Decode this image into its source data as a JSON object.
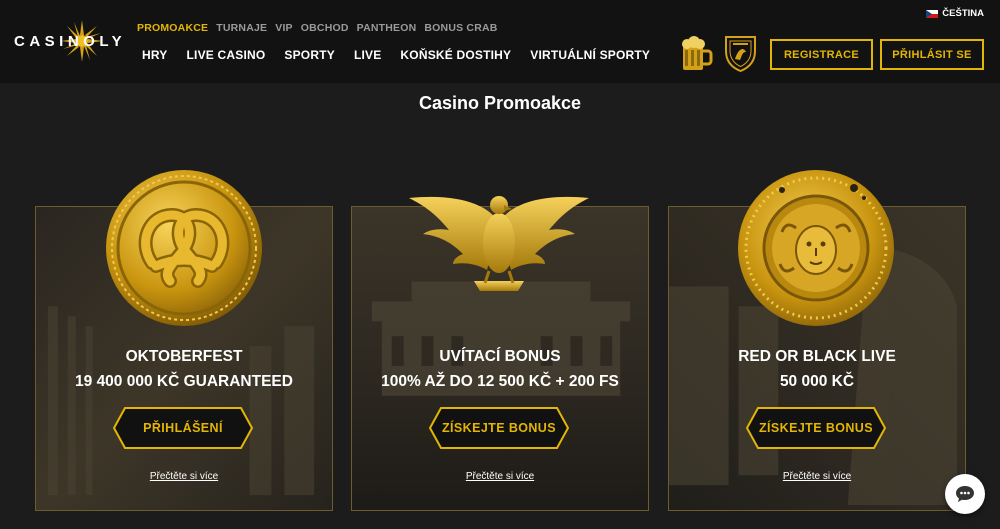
{
  "brand": {
    "logo_text": "CASINOLY",
    "logo_icon": "sun-icon",
    "accent": "#e3b505"
  },
  "language": {
    "label": "ČEŠTINA",
    "flag_icon": "czech-flag-icon"
  },
  "top_nav": [
    {
      "label": "PROMOAKCE",
      "active": true
    },
    {
      "label": "TURNAJE",
      "active": false
    },
    {
      "label": "VIP",
      "active": false
    },
    {
      "label": "OBCHOD",
      "active": false
    },
    {
      "label": "PANTHEON",
      "active": false
    },
    {
      "label": "BONUS CRAB",
      "active": false
    }
  ],
  "main_nav": [
    {
      "label": "HRY"
    },
    {
      "label": "LIVE CASINO"
    },
    {
      "label": "SPORTY"
    },
    {
      "label": "LIVE"
    },
    {
      "label": "KOŇSKÉ DOSTIHY"
    },
    {
      "label": "VIRTUÁLNÍ SPORTY"
    }
  ],
  "header_icons": [
    "beer-mug-icon",
    "lamborghini-shield-icon"
  ],
  "auth": {
    "register_label": "REGISTRACE",
    "login_label": "PŘIHLÁSIT SE"
  },
  "page": {
    "title": "Casino Promoakce"
  },
  "promos": [
    {
      "emblem": "pretzel-coin-icon",
      "title_line1": "OKTOBERFEST",
      "title_line2": "19 400 000 KČ GUARANTEED",
      "button_label": "PŘIHLÁŠENÍ",
      "link_label": "Přečtěte si více"
    },
    {
      "emblem": "golden-eagle-icon",
      "title_line1": "UVÍTACÍ BONUS",
      "title_line2": "100% AŽ DO 12 500 KČ + 200 FS",
      "button_label": "ZÍSKEJTE BONUS",
      "link_label": "Přečtěte si více"
    },
    {
      "emblem": "medusa-coin-icon",
      "title_line1": "RED OR BLACK LIVE",
      "title_line2": "50 000 KČ",
      "button_label": "ZÍSKEJTE BONUS",
      "link_label": "Přečtěte si více"
    }
  ],
  "chat": {
    "icon": "chat-bubble-icon"
  }
}
